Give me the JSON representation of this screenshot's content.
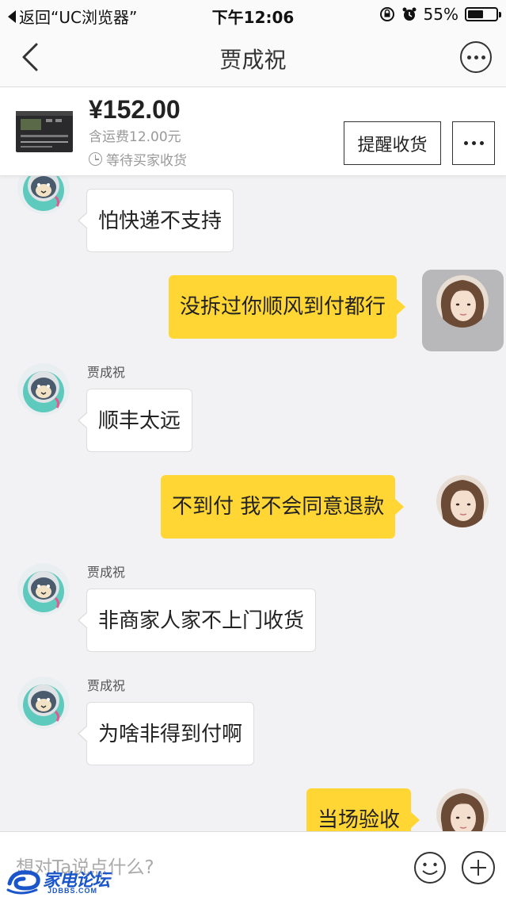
{
  "status_bar": {
    "back_text": "返回“UC浏览器”",
    "time": "下午12:06",
    "battery": "55%",
    "battery_level": 0.55
  },
  "nav": {
    "title": "贾成祝"
  },
  "product": {
    "price": "¥152.00",
    "shipping": "含运费12.00元",
    "status": "等待买家收货",
    "remind_button": "提醒收货"
  },
  "messages": [
    {
      "side": "in",
      "name": "",
      "text": "怕快递不支持"
    },
    {
      "side": "out",
      "name": "",
      "text": "没拆过你顺风到付都行"
    },
    {
      "side": "in",
      "name": "贾成祝",
      "text": "顺丰太远"
    },
    {
      "side": "out",
      "name": "",
      "text": "不到付 我不会同意退款"
    },
    {
      "side": "in",
      "name": "贾成祝",
      "text": "非商家人家不上门收货"
    },
    {
      "side": "in",
      "name": "贾成祝",
      "text": "为啥非得到付啊"
    },
    {
      "side": "out",
      "name": "",
      "text": "当场验收"
    }
  ],
  "input": {
    "placeholder": "想对Ta说点什么?"
  },
  "watermark": {
    "text": "家电论坛",
    "sub": "JDBBS.COM"
  },
  "colors": {
    "outgoing_bubble": "#ffd633",
    "background": "#f2f2f4",
    "watermark": "#1a56c9"
  }
}
